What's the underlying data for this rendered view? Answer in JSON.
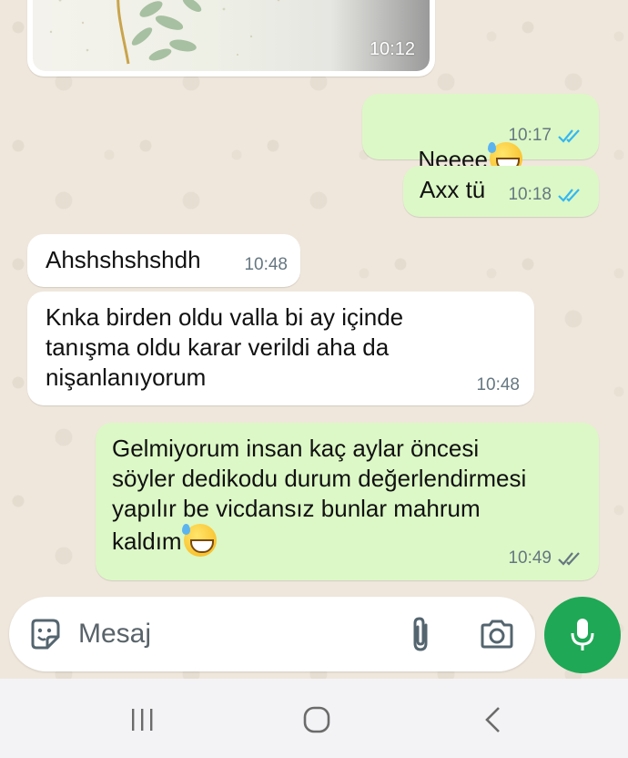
{
  "messages": [
    {
      "id": "img",
      "type": "image",
      "time": "10:12"
    },
    {
      "id": "m1",
      "dir": "out",
      "text": "Neeee",
      "emoji": "sweat-smile",
      "time": "10:17",
      "ticks": "read"
    },
    {
      "id": "m2",
      "dir": "out",
      "text": "Axx tü",
      "time": "10:18",
      "ticks": "read"
    },
    {
      "id": "m3",
      "dir": "in",
      "text": "Ahshshshshdh",
      "time": "10:48"
    },
    {
      "id": "m4",
      "dir": "in",
      "text": "Knka birden oldu valla bi ay içinde\ntanışma oldu karar verildi aha da\nnişanlanıyorum",
      "time": "10:48"
    },
    {
      "id": "m5",
      "dir": "out",
      "text": "Gelmiyorum insan kaç aylar öncesi\nsöyler dedikodu durum değerlendirmesi\nyapılır be vicdansız bunlar mahrum\nkaldım",
      "emoji": "sweat-smile",
      "time": "10:49",
      "ticks": "delivered"
    }
  ],
  "composer": {
    "placeholder": "Mesaj",
    "icons": [
      "sticker-icon",
      "attach-icon",
      "camera-icon"
    ],
    "mic_icon": "mic-icon"
  },
  "navbar": {
    "icons": [
      "recent-apps-icon",
      "home-icon",
      "back-icon"
    ]
  },
  "colors": {
    "chat_bg": "#efe7dc",
    "incoming": "#ffffff",
    "outgoing": "#dcf8c6",
    "read_tick": "#34b7f1",
    "mic": "#1fa855"
  }
}
